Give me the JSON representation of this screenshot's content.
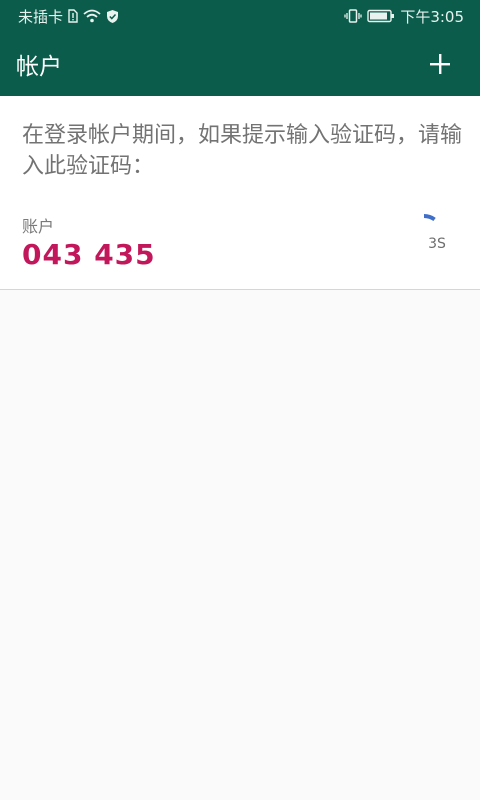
{
  "status_bar": {
    "carrier": "未插卡",
    "time": "下午3:05",
    "icons": [
      "sim-alert-icon",
      "wifi-icon",
      "shield-icon",
      "vibrate-icon",
      "battery-icon"
    ]
  },
  "app_bar": {
    "title": "帐户",
    "add_icon": "plus-icon"
  },
  "card": {
    "instruction": "在登录帐户期间，如果提示输入验证码，请输入此验证码：",
    "account_label": "账户",
    "code": "043 435",
    "timer": {
      "text": "3S",
      "remaining_fraction": 0.1,
      "color": "#3f6fc9"
    }
  },
  "colors": {
    "primary": "#0b5c4b",
    "code": "#c2185b"
  }
}
